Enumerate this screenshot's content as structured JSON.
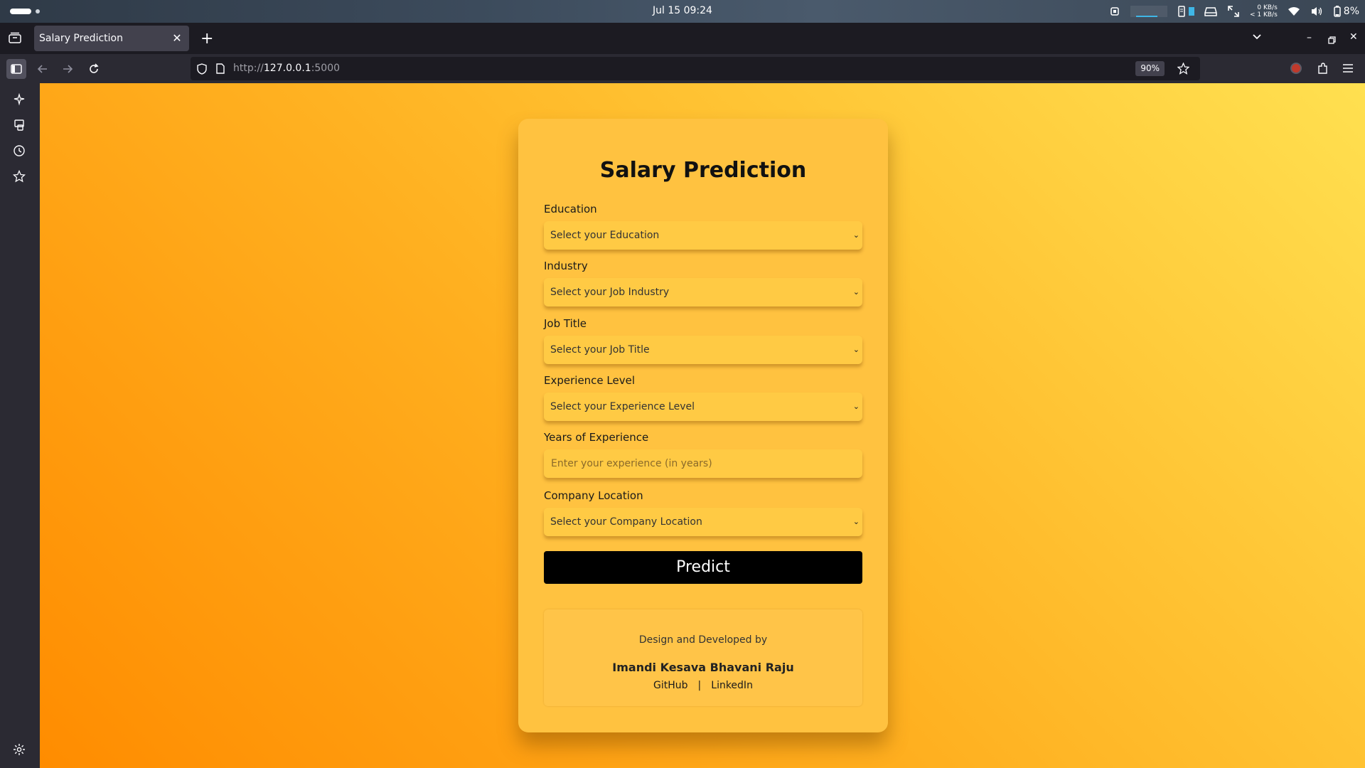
{
  "os": {
    "clock": "Jul 15  09:24",
    "net_down": "0 KB/s",
    "net_up": "< 1 KB/s",
    "battery": "8%"
  },
  "browser": {
    "tab_title": "Salary Prediction",
    "url_host": "127.0.0.1",
    "url_prefix": "http://",
    "url_port": ":5000",
    "zoom": "90%"
  },
  "form": {
    "title": "Salary Prediction",
    "fields": [
      {
        "label": "Education",
        "placeholder": "Select your Education",
        "type": "select"
      },
      {
        "label": "Industry",
        "placeholder": "Select your Job Industry",
        "type": "select"
      },
      {
        "label": "Job Title",
        "placeholder": "Select your Job Title",
        "type": "select"
      },
      {
        "label": "Experience Level",
        "placeholder": "Select your Experience Level",
        "type": "select"
      },
      {
        "label": "Years of Experience",
        "placeholder": "Enter your experience (in years)",
        "type": "input"
      },
      {
        "label": "Company Location",
        "placeholder": "Select your Company Location",
        "type": "select"
      }
    ],
    "submit_label": "Predict"
  },
  "footer": {
    "credit_text": "Design and Developed by",
    "author": "Imandi Kesava Bhavani Raju",
    "link_github": "GitHub",
    "separator": "|",
    "link_linkedin": "LinkedIn"
  },
  "colors": {
    "accent_dark": "#000000",
    "card": "#ffc240",
    "background_start": "#ff8c00",
    "background_end": "#ffe050"
  }
}
